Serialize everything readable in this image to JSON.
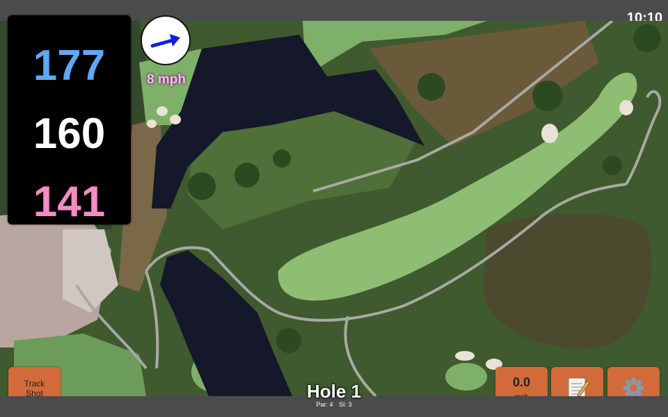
{
  "status_bar": {
    "time": "10:10"
  },
  "distances": {
    "back": "177",
    "middle": "160",
    "front": "141"
  },
  "wind": {
    "speed": "8 mph",
    "direction_icon": "arrow-icon"
  },
  "buttons": {
    "track_shot": {
      "line1": "Track",
      "line2": "Shot"
    },
    "speed": {
      "value": "0.0",
      "unit": "mph"
    },
    "notes_icon": "notepad-icon",
    "settings_icon": "gear-icon"
  },
  "hole": {
    "title": "Hole 1",
    "par": "Par: 4",
    "si": "SI: 3"
  },
  "colors": {
    "back": "#5fa8f2",
    "middle": "#ffffff",
    "front": "#f48cc6",
    "button": "#d26a3a"
  }
}
